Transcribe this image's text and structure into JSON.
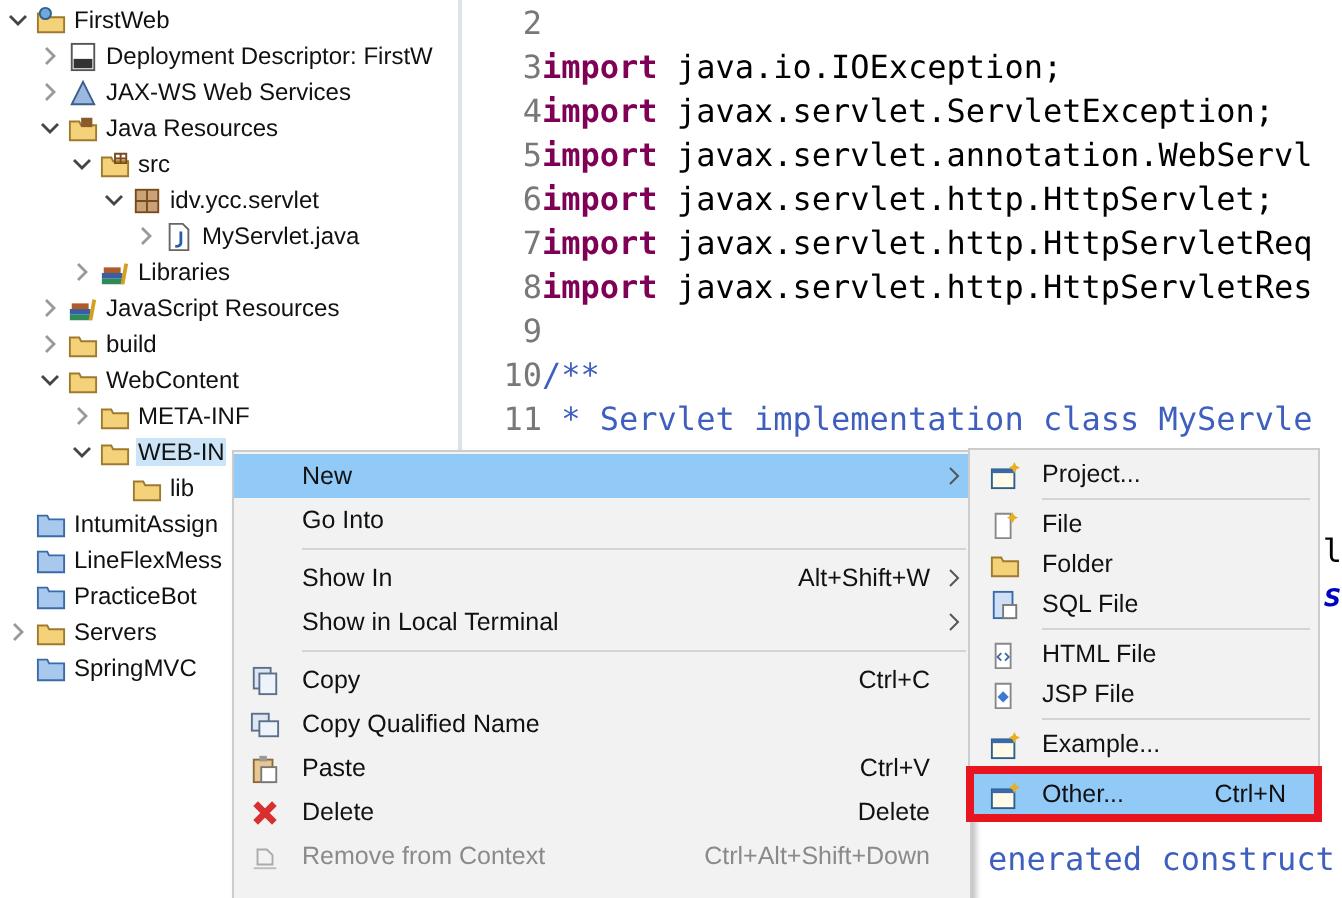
{
  "project_tree": [
    {
      "label": "FirstWeb",
      "kind": "project",
      "expanded": true,
      "selected": false,
      "children": [
        {
          "label": "Deployment Descriptor: FirstW",
          "kind": "descriptor",
          "expanded": false,
          "selected": false
        },
        {
          "label": "JAX-WS Web Services",
          "kind": "webservices",
          "expanded": false,
          "selected": false
        },
        {
          "label": "Java Resources",
          "kind": "resources",
          "expanded": true,
          "selected": false,
          "children": [
            {
              "label": "src",
              "kind": "sourcefolder",
              "expanded": true,
              "selected": false,
              "children": [
                {
                  "label": "idv.ycc.servlet",
                  "kind": "package",
                  "expanded": true,
                  "selected": false,
                  "children": [
                    {
                      "label": "MyServlet.java",
                      "kind": "javafile",
                      "expanded": false,
                      "selected": false
                    }
                  ]
                }
              ]
            },
            {
              "label": "Libraries",
              "kind": "library",
              "expanded": false,
              "selected": false
            }
          ]
        },
        {
          "label": "JavaScript Resources",
          "kind": "library",
          "expanded": false,
          "selected": false
        },
        {
          "label": "build",
          "kind": "folder",
          "expanded": false,
          "selected": false
        },
        {
          "label": "WebContent",
          "kind": "folder",
          "expanded": true,
          "selected": false,
          "children": [
            {
              "label": "META-INF",
              "kind": "folder",
              "expanded": false,
              "selected": false
            },
            {
              "label": "WEB-IN",
              "kind": "folder",
              "expanded": true,
              "selected": true,
              "children": [
                {
                  "label": "lib",
                  "kind": "folder",
                  "selected": false
                }
              ]
            }
          ]
        }
      ]
    },
    {
      "label": "IntumitAssign",
      "kind": "closedproject",
      "selected": false
    },
    {
      "label": "LineFlexMess",
      "kind": "closedproject",
      "selected": false
    },
    {
      "label": "PracticeBot",
      "kind": "closedproject",
      "selected": false
    },
    {
      "label": "Servers",
      "kind": "folder",
      "expanded": false,
      "selected": false
    },
    {
      "label": "SpringMVC",
      "kind": "closedproject",
      "selected": false
    }
  ],
  "editor": {
    "lines": [
      {
        "kind": "code",
        "number": "2"
      },
      {
        "kind": "code",
        "number": "3",
        "keyword": "import",
        "text": " java.io.IOException;"
      },
      {
        "kind": "code",
        "number": "4",
        "keyword": "import",
        "text": " javax.servlet.ServletException;"
      },
      {
        "kind": "code",
        "number": "5",
        "keyword": "import",
        "text": " javax.servlet.annotation.WebServl"
      },
      {
        "kind": "code",
        "number": "6",
        "keyword": "import",
        "text": " javax.servlet.http.HttpServlet;"
      },
      {
        "kind": "code",
        "number": "7",
        "keyword": "import",
        "text": " javax.servlet.http.HttpServletReq"
      },
      {
        "kind": "code",
        "number": "8",
        "keyword": "import",
        "text": " javax.servlet.http.HttpServletRes"
      },
      {
        "kind": "code",
        "number": "9"
      },
      {
        "kind": "comment",
        "number": "10",
        "text": "/**"
      },
      {
        "kind": "comment",
        "number": "11",
        "text": " * Servlet implementation class MyServle"
      },
      {
        "kind": "hidden"
      },
      {
        "kind": "hidden"
      },
      {
        "kind": "tail",
        "text": "l"
      },
      {
        "kind": "field",
        "text": "s"
      },
      {
        "kind": "hidden"
      },
      {
        "kind": "hidden"
      },
      {
        "kind": "hidden"
      },
      {
        "kind": "hidden"
      },
      {
        "kind": "hidden"
      },
      {
        "kind": "remark",
        "text": "enerated construct"
      }
    ]
  },
  "context_menu": {
    "items": [
      {
        "kind": "plain",
        "label": "New",
        "submenu": true,
        "selected": true,
        "disabled": false
      },
      {
        "kind": "plain",
        "label": "Go Into",
        "submenu": false,
        "selected": false,
        "disabled": false
      },
      {
        "kind": "separator"
      },
      {
        "kind": "plain",
        "label": "Show In",
        "shortcut": "Alt+Shift+W",
        "submenu": true,
        "selected": false,
        "disabled": false
      },
      {
        "kind": "plain",
        "label": "Show in Local Terminal",
        "submenu": true,
        "selected": false,
        "disabled": false
      },
      {
        "kind": "separator"
      },
      {
        "kind": "copy",
        "label": "Copy",
        "shortcut": "Ctrl+C",
        "submenu": false,
        "selected": false,
        "disabled": false
      },
      {
        "kind": "copyname",
        "label": "Copy Qualified Name",
        "submenu": false,
        "selected": false,
        "disabled": false
      },
      {
        "kind": "paste",
        "label": "Paste",
        "shortcut": "Ctrl+V",
        "submenu": false,
        "selected": false,
        "disabled": false
      },
      {
        "kind": "delete",
        "label": "Delete",
        "shortcut": "Delete",
        "submenu": false,
        "selected": false,
        "disabled": false
      },
      {
        "kind": "remove",
        "label": "Remove from Context",
        "shortcut": "Ctrl+Alt+Shift+Down",
        "submenu": false,
        "selected": false,
        "disabled": true
      }
    ]
  },
  "new_submenu": {
    "items": [
      {
        "kind": "wizard",
        "label": "Project...",
        "selected": false
      },
      {
        "kind": "separator"
      },
      {
        "kind": "file",
        "label": "File",
        "selected": false
      },
      {
        "kind": "folder",
        "label": "Folder",
        "selected": false
      },
      {
        "kind": "sql",
        "label": "SQL File",
        "selected": false
      },
      {
        "kind": "separator"
      },
      {
        "kind": "html",
        "label": "HTML File",
        "selected": false
      },
      {
        "kind": "jsp",
        "label": "JSP File",
        "selected": false
      },
      {
        "kind": "separator"
      },
      {
        "kind": "wizard",
        "label": "Example...",
        "selected": false
      },
      {
        "kind": "separator"
      },
      {
        "kind": "wizard",
        "label": "Other...",
        "shortcut": "Ctrl+N",
        "selected": true
      }
    ]
  }
}
